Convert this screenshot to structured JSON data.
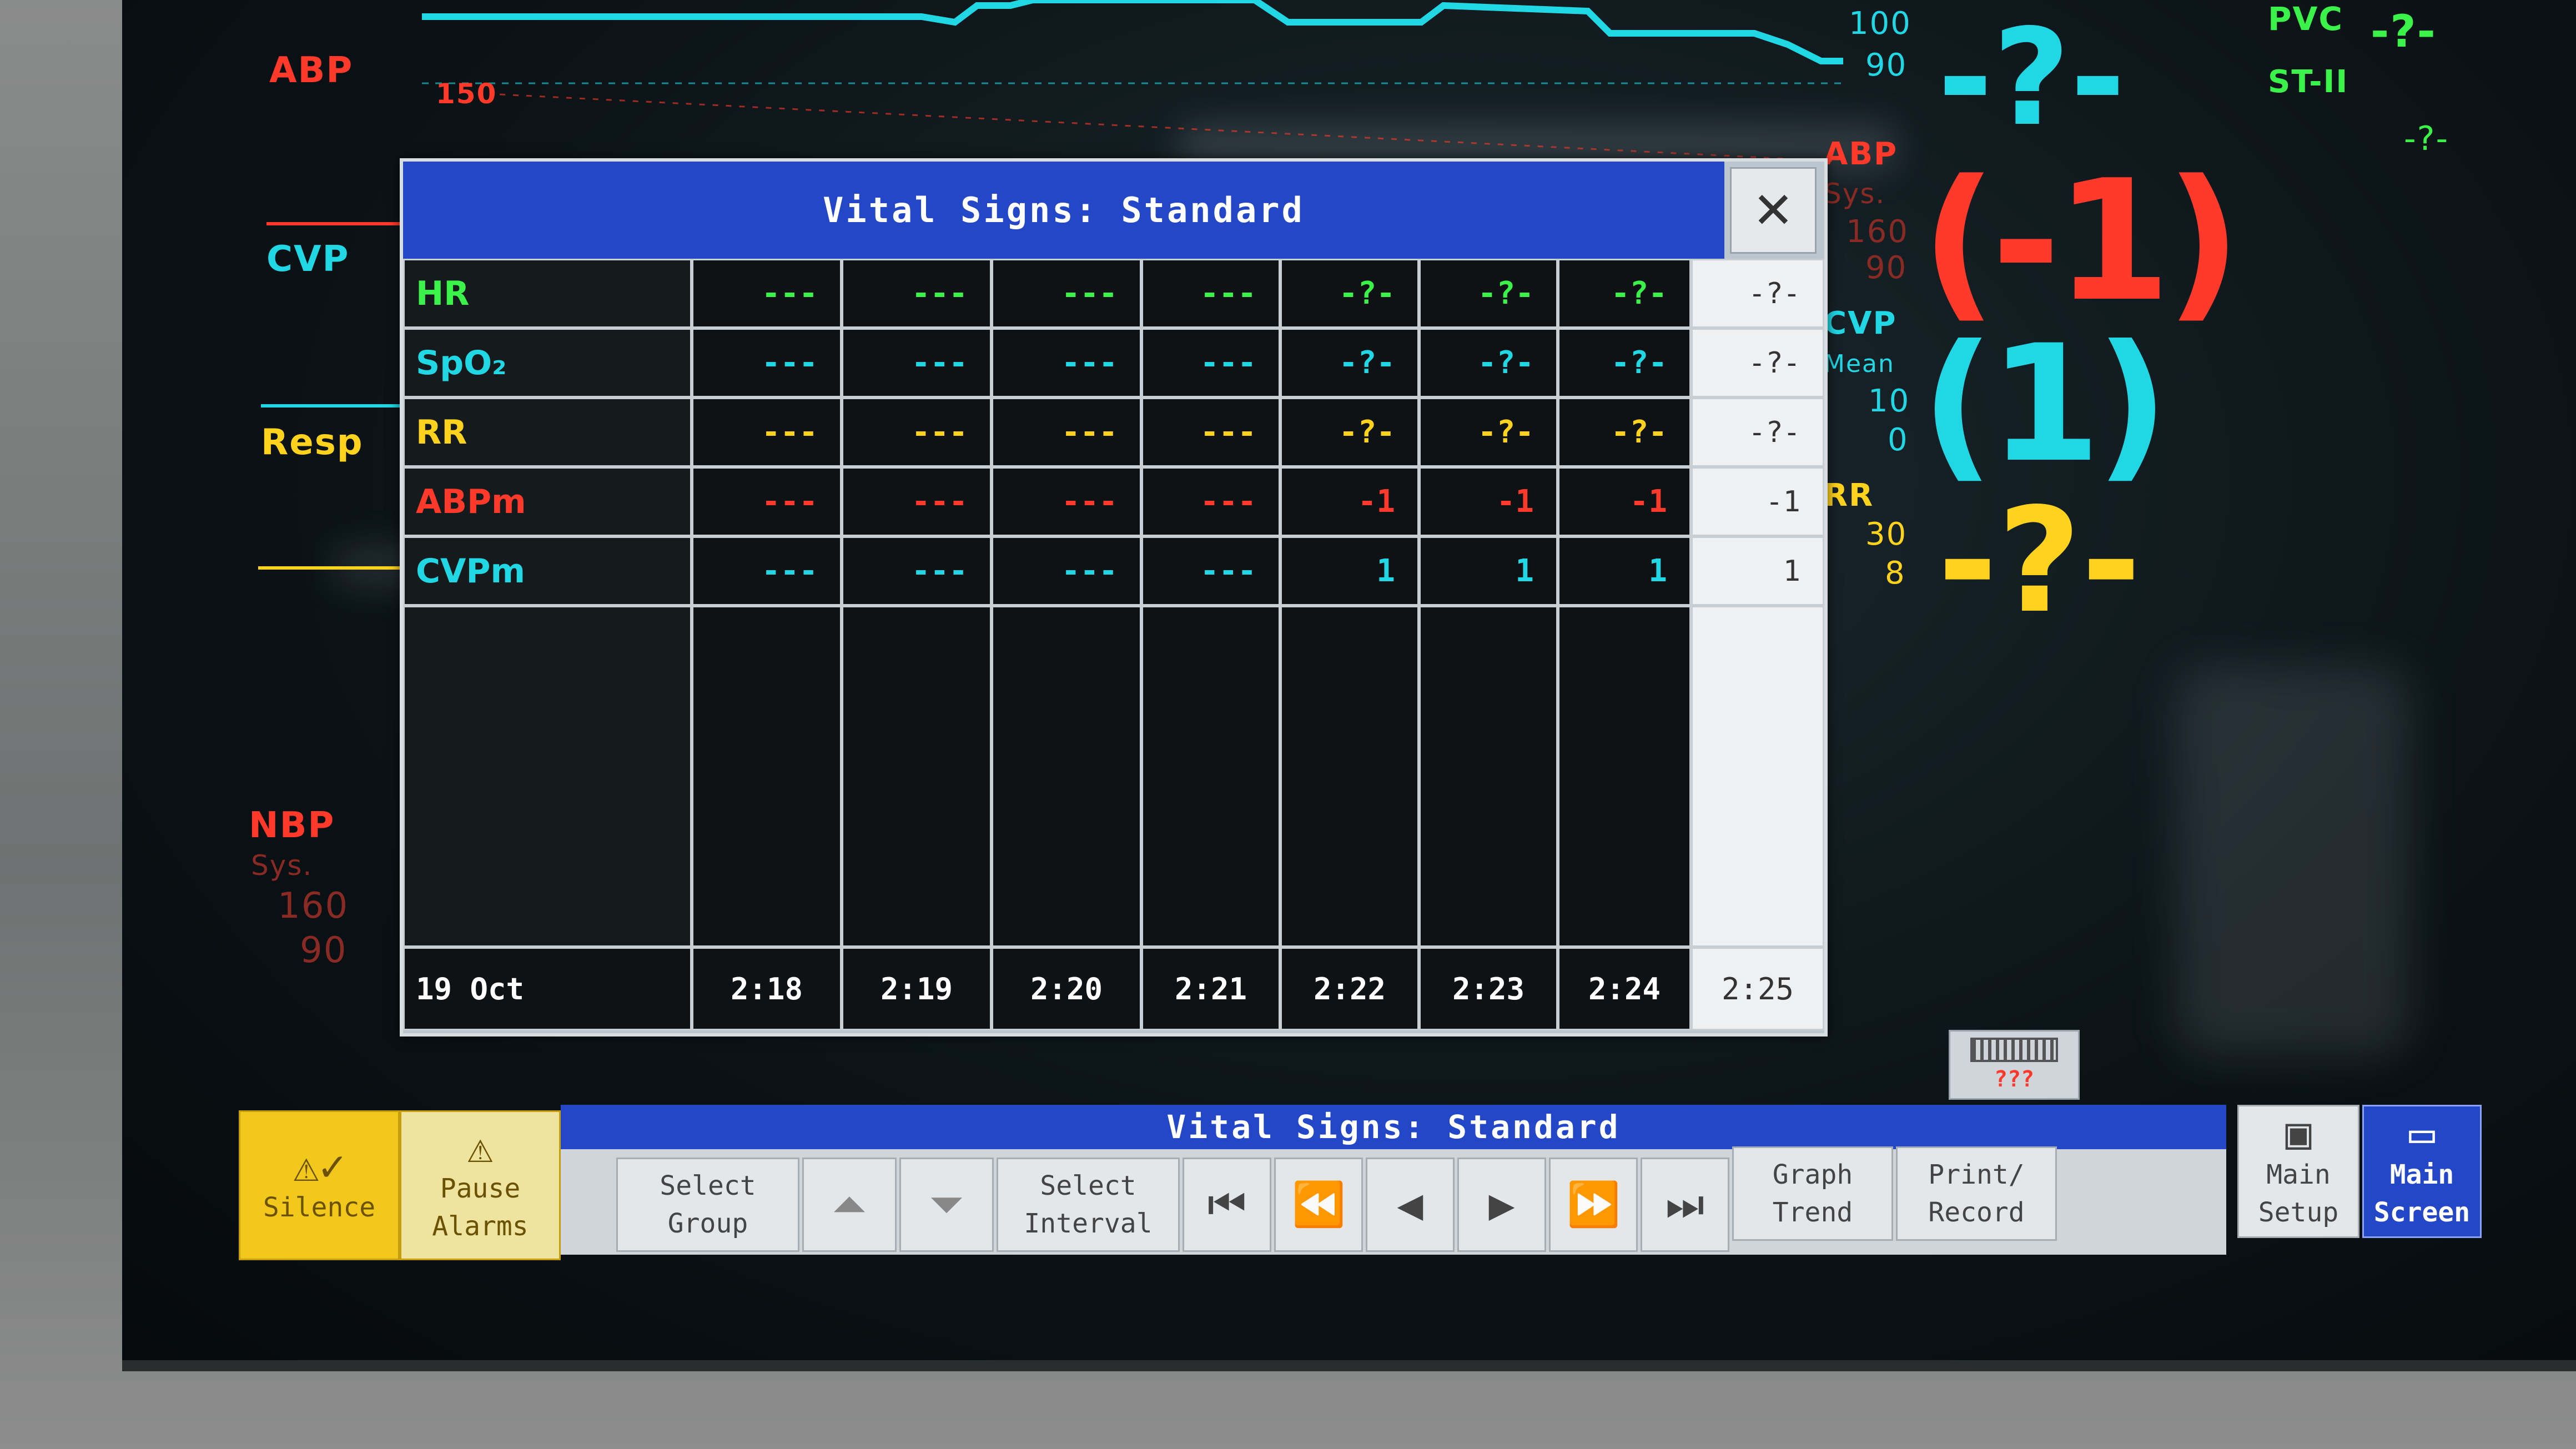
{
  "channels": {
    "abp_label": "ABP",
    "abp_scale": "150",
    "cvp_label": "CVP",
    "resp_label": "Resp",
    "nbp_label": "NBP",
    "nbp_sub": "Sys.",
    "nbp_high": "160",
    "nbp_low": "90"
  },
  "right_panel": {
    "top_hi": "100",
    "top_lo": "90",
    "top_value": "-?-",
    "pvc_label": "PVC",
    "pvc_value": "-?-",
    "st_label": "ST-II",
    "st_value": "-?-",
    "abp_label": "ABP",
    "abp_sub": "Sys.",
    "abp_hi": "160",
    "abp_lo": "90",
    "abp_value": "(-1)",
    "cvp_label": "CVP",
    "cvp_sub": "Mean",
    "cvp_hi": "10",
    "cvp_lo": "0",
    "cvp_value": "(1)",
    "rr_label": "RR",
    "rr_hi": "30",
    "rr_lo": "8",
    "rr_value": "-?-"
  },
  "dialog": {
    "title": "Vital Signs: Standard",
    "close_symbol": "✕",
    "rows": [
      {
        "name": "HR",
        "color": "#3bf24a",
        "values": [
          "---",
          "---",
          "---",
          "---",
          "-?-",
          "-?-",
          "-?-"
        ],
        "current": "-?-"
      },
      {
        "name": "SpO₂",
        "color": "#21d7e4",
        "values": [
          "---",
          "---",
          "---",
          "---",
          "-?-",
          "-?-",
          "-?-"
        ],
        "current": "-?-"
      },
      {
        "name": "RR",
        "color": "#ffd21e",
        "values": [
          "---",
          "---",
          "---",
          "---",
          "-?-",
          "-?-",
          "-?-"
        ],
        "current": "-?-"
      },
      {
        "name": "ABPm",
        "color": "#ff3a2a",
        "values": [
          "---",
          "---",
          "---",
          "---",
          "-1",
          "-1",
          "-1"
        ],
        "current": "-1"
      },
      {
        "name": "CVPm",
        "color": "#21d7e4",
        "values": [
          "---",
          "---",
          "---",
          "---",
          "1",
          "1",
          "1"
        ],
        "current": "1"
      }
    ],
    "date": "19 Oct",
    "times": [
      "2:18",
      "2:19",
      "2:20",
      "2:21",
      "2:22",
      "2:23",
      "2:24"
    ],
    "current_time": "2:25"
  },
  "toolbar": {
    "title": "Vital Signs: Standard",
    "silence_label": "Silence",
    "pause_line1": "Pause",
    "pause_line2": "Alarms",
    "select_group_line1": "Select",
    "select_group_line2": "Group",
    "select_interval_line1": "Select",
    "select_interval_line2": "Interval",
    "graph_trend_line1": "Graph",
    "graph_trend_line2": "Trend",
    "print_line1": "Print/",
    "print_line2": "Record",
    "main_setup_line1": "Main",
    "main_setup_line2": "Setup",
    "main_screen_line1": "Main",
    "main_screen_line2": "Screen",
    "battery_text": "???"
  }
}
